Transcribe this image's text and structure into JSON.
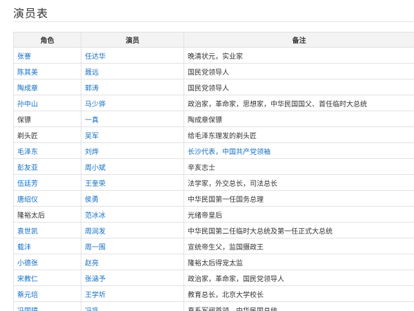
{
  "page": {
    "title": "演员表"
  },
  "colors": {
    "link": "#136ec2",
    "text": "#333333",
    "header_bg": "#f3f3f3",
    "border": "#e1e1e1"
  },
  "table": {
    "headers": [
      "角色",
      "演员",
      "备注"
    ],
    "rows": [
      {
        "role": "张謇",
        "role_link": true,
        "actor": "任达华",
        "actor_link": true,
        "note": "晚清状元，实业家",
        "note_link": false
      },
      {
        "role": "陈其美",
        "role_link": true,
        "actor": "聂远",
        "actor_link": true,
        "note": "国民党领导人",
        "note_link": false
      },
      {
        "role": "陶成章",
        "role_link": true,
        "actor": "郭涛",
        "actor_link": true,
        "note": "国民党领导人",
        "note_link": false
      },
      {
        "role": "孙中山",
        "role_link": true,
        "actor": "马少骅",
        "actor_link": true,
        "note": "政治家，革命家，思想家，中华民国国父、首任临时大总统",
        "note_link": false
      },
      {
        "role": "保镖",
        "role_link": false,
        "actor": "一真",
        "actor_link": true,
        "note": "陶成章保镖",
        "note_link": false
      },
      {
        "role": "剃头匠",
        "role_link": false,
        "actor": "吴军",
        "actor_link": true,
        "note": "给毛泽东理发的剃头匠",
        "note_link": false
      },
      {
        "role": "毛泽东",
        "role_link": true,
        "actor": "刘烨",
        "actor_link": true,
        "note": "长沙代表，中国共产党领袖",
        "note_link": true
      },
      {
        "role": "彭友亚",
        "role_link": true,
        "actor": "周小斌",
        "actor_link": true,
        "note": "辛亥志士",
        "note_link": false
      },
      {
        "role": "伍廷芳",
        "role_link": true,
        "actor": "王奎荣",
        "actor_link": true,
        "note": "法学家，外交总长，司法总长",
        "note_link": false
      },
      {
        "role": "唐绍仪",
        "role_link": true,
        "actor": "侯勇",
        "actor_link": true,
        "note": "中华民国第一任国务总理",
        "note_link": false
      },
      {
        "role": "隆裕太后",
        "role_link": false,
        "actor": "范冰冰",
        "actor_link": true,
        "note": "光绪帝皇后",
        "note_link": false
      },
      {
        "role": "袁世凯",
        "role_link": true,
        "actor": "周润发",
        "actor_link": true,
        "note": "中华民国第二任临时大总统及第一任正式大总统",
        "note_link": false
      },
      {
        "role": "载沣",
        "role_link": true,
        "actor": "周一围",
        "actor_link": true,
        "note": "宣统帝生父，监国摄政王",
        "note_link": false
      },
      {
        "role": "小德张",
        "role_link": true,
        "actor": "赵亮",
        "actor_link": true,
        "note": "隆裕太后得宠太监",
        "note_link": false
      },
      {
        "role": "宋教仁",
        "role_link": true,
        "actor": "张涵予",
        "actor_link": true,
        "note": "政治家，革命家，国民党领导人",
        "note_link": false
      },
      {
        "role": "蔡元培",
        "role_link": true,
        "actor": "王学圻",
        "actor_link": true,
        "note": "教育总长，北京大学校长",
        "note_link": false
      },
      {
        "role": "冯国璋",
        "role_link": true,
        "actor": "冯巩",
        "actor_link": true,
        "note": "直系军阀首领，中华民国总统",
        "note_link": false
      }
    ]
  }
}
